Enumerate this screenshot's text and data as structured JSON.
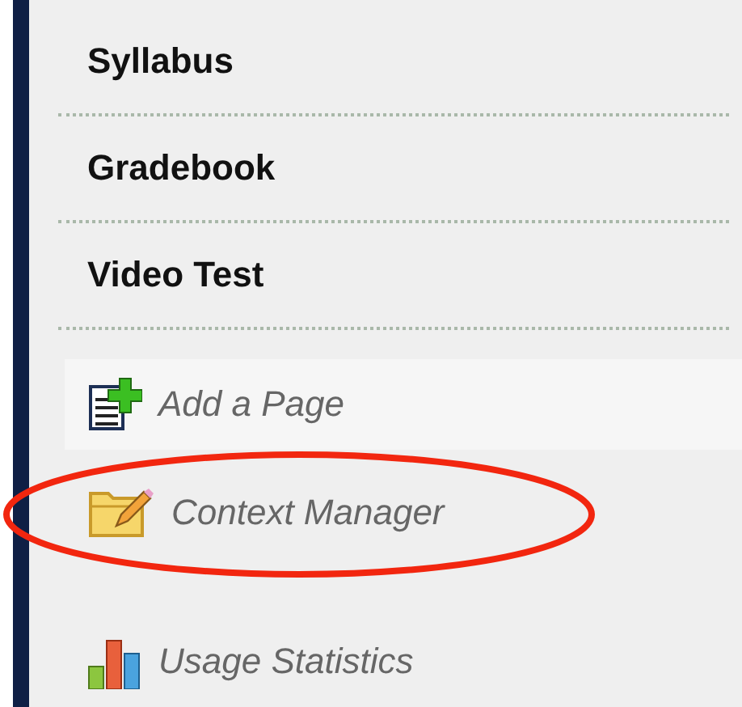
{
  "nav_items": [
    {
      "label": "Syllabus"
    },
    {
      "label": "Gradebook"
    },
    {
      "label": "Video Test"
    }
  ],
  "tools": [
    {
      "label": "Add a Page",
      "kind": "add-page",
      "highlighted": false
    },
    {
      "label": "Context Manager",
      "kind": "folder-edit",
      "highlighted": true
    },
    {
      "label": "Usage Statistics",
      "kind": "stats",
      "highlighted": false
    }
  ]
}
